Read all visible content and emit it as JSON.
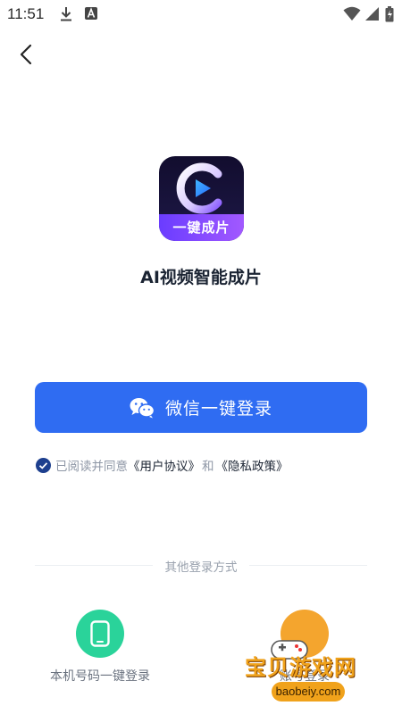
{
  "status_bar": {
    "time": "11:51",
    "icons": [
      "download-icon",
      "a-badge-icon",
      "wifi-icon",
      "signal-icon",
      "battery-icon"
    ]
  },
  "header": {
    "back_icon": "chevron-left-icon"
  },
  "app": {
    "logo_text": "一键成片",
    "name": "AI视频智能成片",
    "colors": {
      "logo_bg": "#120d2e",
      "logo_band": "#a259ff"
    }
  },
  "login": {
    "wechat_button_label": "微信一键登录",
    "wechat_icon": "wechat-icon",
    "accent_color": "#2f6cf2"
  },
  "agreement": {
    "prefix": "已阅读并同意",
    "user_agreement": "《用户协议》",
    "and": "和",
    "privacy_policy": "《隐私政策》",
    "checked": true
  },
  "other_login": {
    "title": "其他登录方式",
    "methods": [
      {
        "label": "本机号码一键登录",
        "icon": "phone-icon",
        "color": "#2ad39a"
      },
      {
        "label": "账号登录",
        "icon": "user-icon",
        "color": "#f4a52e"
      }
    ]
  },
  "watermark": {
    "title": "宝贝游戏网",
    "url": "baobeiy.com"
  }
}
